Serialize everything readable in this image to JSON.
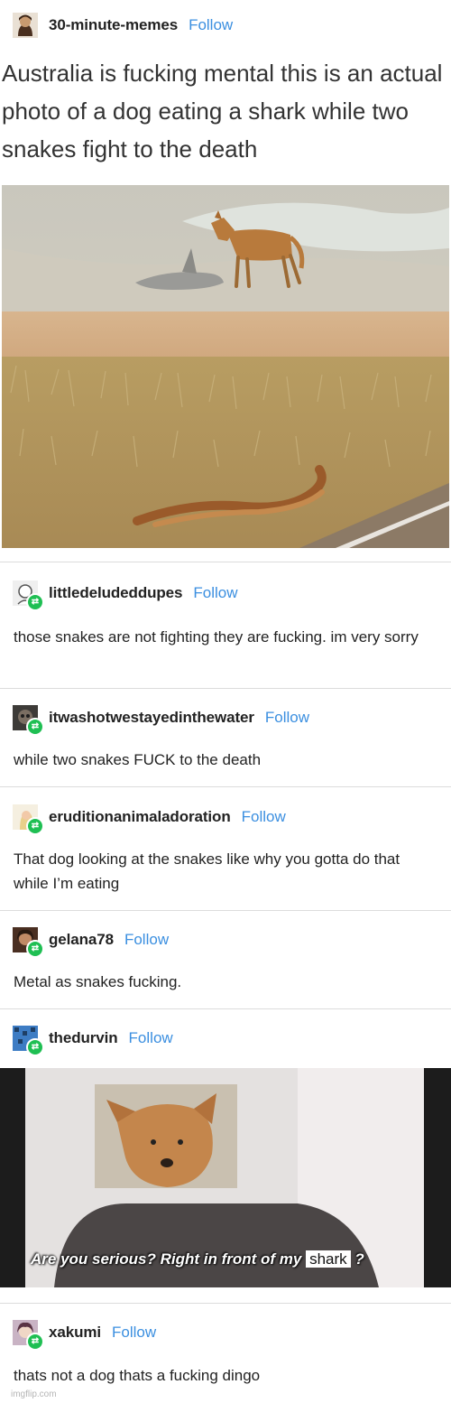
{
  "follow_label": "Follow",
  "op": {
    "username": "30-minute-memes",
    "title": "Australia is fucking mental this is an actual photo of a dog eating a shark while two snakes fight to the death"
  },
  "replies": [
    {
      "username": "littledeludeddupes",
      "text": "those snakes are not fighting they are fucking. im very sorry"
    },
    {
      "username": "itwashotwestayedinthewater",
      "text": "while two snakes FUCK to the death"
    },
    {
      "username": "eruditionanimaladoration",
      "text": "That dog looking at the snakes like why you gotta do that while I’m eating"
    },
    {
      "username": "gelana78",
      "text": "Metal as snakes fucking."
    },
    {
      "username": "thedurvin",
      "text": ""
    },
    {
      "username": "xakumi",
      "text": "thats not a dog thats a fucking dingo"
    }
  ],
  "meme": {
    "caption_part1": "Are you serious? Right in front of my",
    "caption_sticker": "shark",
    "caption_part2": "?"
  },
  "watermark": "imgflip.com",
  "colors": {
    "follow": "#3b8fe0",
    "reblog_badge": "#1fbf53"
  }
}
